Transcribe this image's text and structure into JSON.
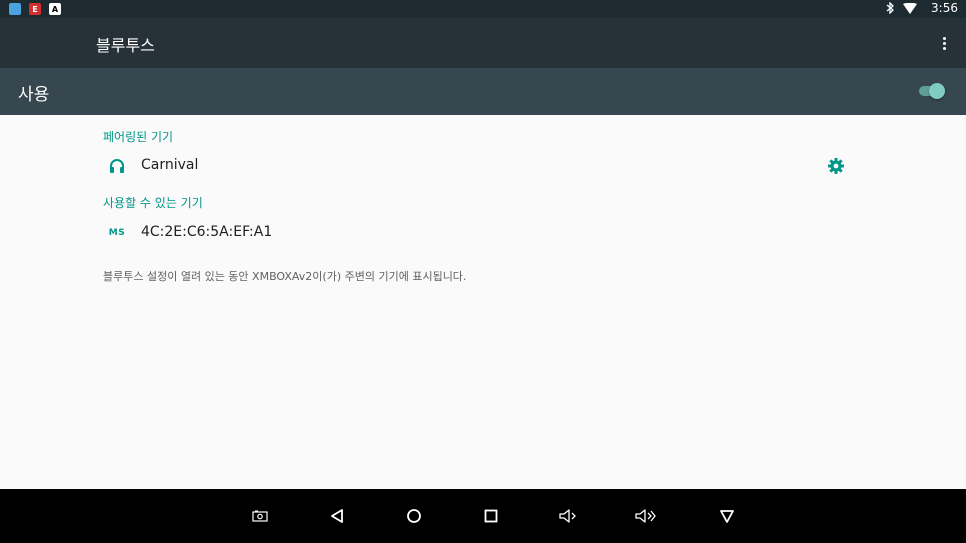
{
  "status_bar": {
    "notification_icons": [
      "app-notification-icon",
      "e-notification-icon",
      "a-notification-icon"
    ],
    "icon_letters": [
      "",
      "E",
      "A"
    ],
    "time": "3:56"
  },
  "toolbar": {
    "title": "블루투스"
  },
  "switch_bar": {
    "label": "사용",
    "enabled": true
  },
  "paired": {
    "header": "페어링된 기기",
    "devices": [
      {
        "name": "Carnival",
        "icon": "headphones-icon"
      }
    ]
  },
  "available": {
    "header": "사용할 수 있는 기기",
    "devices": [
      {
        "name": "4C:2E:C6:5A:EF:A1",
        "icon_label": "MS"
      }
    ]
  },
  "footer_text": "블루투스 설정이 열려 있는 동안 XMBOXAv2이(가) 주변의 기기에 표시됩니다.",
  "colors": {
    "accent": "#009688",
    "toolbar": "#263238",
    "switch_bar": "#37474f",
    "background": "#fafafa"
  }
}
